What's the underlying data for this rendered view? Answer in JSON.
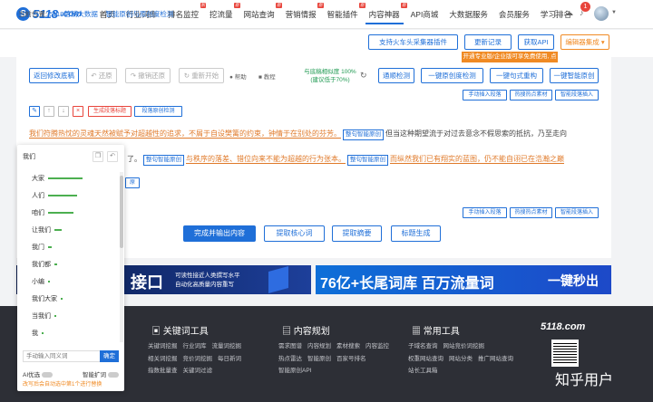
{
  "brand": {
    "logo_text": "5118",
    "logo_suffix": ".com"
  },
  "nav": {
    "items": [
      {
        "label": "首页",
        "active": false,
        "tag": ""
      },
      {
        "label": "行业词库",
        "active": false,
        "tag": ""
      },
      {
        "label": "排名监控",
        "active": false,
        "tag": "新"
      },
      {
        "label": "挖流量",
        "active": false,
        "tag": "新"
      },
      {
        "label": "网站查询",
        "active": false,
        "tag": "新"
      },
      {
        "label": "营销情报",
        "active": false,
        "tag": "新"
      },
      {
        "label": "智能插件",
        "active": false,
        "tag": "新"
      },
      {
        "label": "内容神器",
        "active": true,
        "tag": "新"
      },
      {
        "label": "API商城",
        "active": false,
        "tag": ""
      },
      {
        "label": "大数据服务",
        "active": false,
        "tag": ""
      },
      {
        "label": "会员服务",
        "active": false,
        "tag": ""
      },
      {
        "label": "学习排名",
        "active": false,
        "tag": ""
      }
    ],
    "notification_count": "1"
  },
  "breadcrumb": {
    "prefix": "当前位置:",
    "home": "5118营销大数据",
    "sep": ">",
    "current": "智能原创与原创度检测"
  },
  "top_buttons": {
    "plugin": "支持火车头采集器插件",
    "changelog": "更新记录",
    "get_api": "获取API",
    "editor_integration": "编辑器集成"
  },
  "promo": "开通专业版/企业版可享免费使用, 点击开通",
  "toolbar": {
    "back": "返回修改底稿",
    "restore": "还原",
    "undo_restore": "撤销还原",
    "restart": "重新开始",
    "help": "帮助",
    "tutorial": "教程",
    "similarity_line1": "与底稿相似度 100%",
    "similarity_line2": "(建议低于70%)",
    "check": "通顺检测",
    "one_click_check": "一键原创度检测",
    "rewrite_sentence": "一键句式重构",
    "one_click_original": "一键智能原创"
  },
  "para_actions": {
    "insert_paragraph": "手动插入段落",
    "hot_material": "热搜热点素材",
    "smart_paragraph": "智能段落插入"
  },
  "format_tools": {
    "generate_title": "生成段落标题",
    "originality_check": "段落原创检测"
  },
  "content": {
    "line1_a": "我们符腾热忱的灵魂天然被赋予对超越性的追求，不屑于自设樊篱的约束，钟情于在别处的芬芳。",
    "line1_btn": "整句智能原创",
    "line1_b": "但当这种期望流于对过去意念不假思索的抵抗，乃至走向",
    "line2_a": "了。",
    "line2_btn": "整句智能原创",
    "line2_b": "与秩序的落差、错位向来不能为超越的行为张本。",
    "line2_btn2": "整句智能原创",
    "line2_c": "而纵然我们已有翔实的蓝图，仍不能自诩已在浩瀚之巅"
  },
  "bottom_buttons": {
    "finish": "完成并输出内容",
    "extract_keywords": "提取核心词",
    "extract_summary": "提取摘要",
    "generate_title": "标题生成"
  },
  "popup": {
    "title": "我们",
    "items": [
      {
        "label": "大家",
        "strength": 0.95
      },
      {
        "label": "人们",
        "strength": 0.8
      },
      {
        "label": "咱们",
        "strength": 0.7
      },
      {
        "label": "让我们",
        "strength": 0.2
      },
      {
        "label": "我门",
        "strength": 0.1
      },
      {
        "label": "我们都",
        "strength": 0.08
      },
      {
        "label": "小编",
        "strength": 0.06
      },
      {
        "label": "我们大家",
        "strength": 0.05
      },
      {
        "label": "当我们",
        "strength": 0.04
      },
      {
        "label": "我",
        "strength": 0.03
      }
    ],
    "input_placeholder": "手动输入同义词",
    "confirm": "确定",
    "ai_label": "AI优选",
    "smart_expand": "智能扩词",
    "warning": "改写后会自动选中第1个进行替换"
  },
  "banners": {
    "b1_title": "接口",
    "b1_sub1": "可读性接近人类撰写水平",
    "b1_sub2": "自动化高质量内容重写",
    "b2_title": "76亿+长尾词库 百万流量词",
    "b2_cta": "一键秒出"
  },
  "footer": {
    "col1_title": "关键词工具",
    "col1_links": [
      "关键词挖掘",
      "行业词库",
      "流量词挖掘",
      "相关词挖掘",
      "竞价词挖掘",
      "每日新词",
      "指数批量查",
      "关键词过滤"
    ],
    "col2_title": "内容规划",
    "col2_links": [
      "需求图谱",
      "内容规划",
      "素材搜索",
      "内容监控",
      "热点雷达",
      "智能原创",
      "百家号排名",
      "智能原创API"
    ],
    "col3_title": "常用工具",
    "col3_links": [
      "子域名查询",
      "网站竞价词挖掘",
      "权重网站查询",
      "网站分类",
      "推广网站查询",
      "站长工具箱"
    ],
    "brand": "5118.com",
    "watermark": "知乎用户"
  }
}
